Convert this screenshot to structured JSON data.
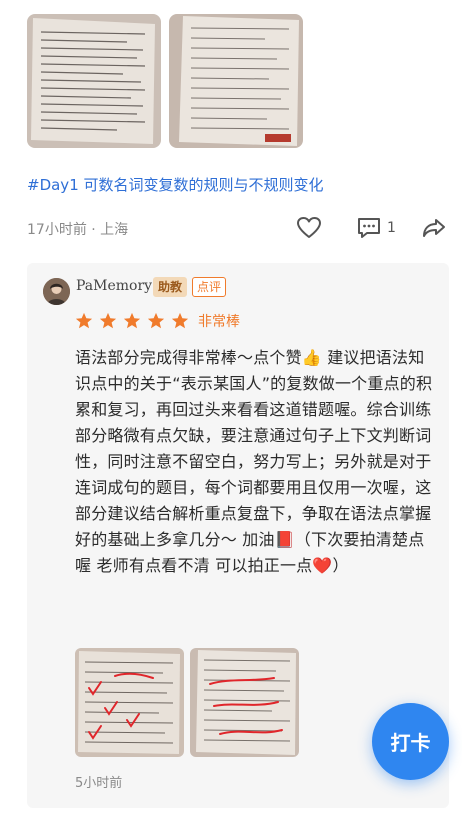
{
  "post": {
    "text": "#Day1 可数名词变复数的规则与不规则变化",
    "meta": "17小时前 · 上海",
    "comment_count": "1"
  },
  "review": {
    "reviewer_name": "PaMemory",
    "badge_assistant": "助教",
    "badge_review": "点评",
    "stars": 5,
    "rating_label": "非常棒",
    "body": "语法部分完成得非常棒～点个赞👍 建议把语法知识点中的关于“表示某国人”的复数做一个重点的积累和复习，再回过头来看看这道错题喔。综合训练部分略微有点欠缺，要注意通过句子上下文判断词性，同时注意不留空白，努力写上；另外就是对于连词成句的题目，每个词都要用且仅用一次喔，这部分建议结合解析重点复盘下，争取在语法点掌握好的基础上多拿几分～ 加油📕（下次要拍清楚点喔 老师有点看不清 可以拍正一点❤️）",
    "time": "5小时前"
  },
  "fab": {
    "label": "打卡"
  },
  "colors": {
    "accent": "#2f86f0",
    "link": "#2f6fd6",
    "star": "#f07b2c"
  },
  "icons": [
    "heart-icon",
    "comment-icon",
    "share-icon",
    "star-icon"
  ]
}
